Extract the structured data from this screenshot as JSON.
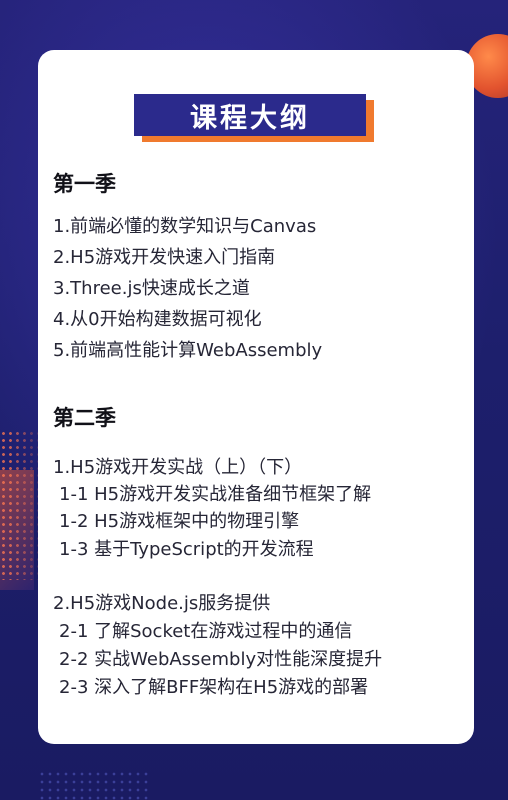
{
  "title": "课程大纲",
  "season1": {
    "heading": "第一季",
    "items": [
      "1.前端必懂的数学知识与Canvas",
      "2.H5游戏开发快速入门指南",
      "3.Three.js快速成长之道",
      "4.从0开始构建数据可视化",
      "5.前端高性能计算WebAssembly"
    ]
  },
  "season2": {
    "heading": "第二季",
    "group1": {
      "title": "1.H5游戏开发实战（上）（下）",
      "items": [
        "1-1 H5游戏开发实战准备细节框架了解",
        "1-2 H5游戏框架中的物理引擎",
        "1-3 基于TypeScript的开发流程"
      ]
    },
    "group2": {
      "title": "2.H5游戏Node.js服务提供",
      "items": [
        "2-1 了解Socket在游戏过程中的通信",
        "2-2 实战WebAssembly对性能深度提升",
        "2-3 深入了解BFF架构在H5游戏的部署"
      ]
    }
  },
  "colors": {
    "background": "#1e1f6e",
    "title_box": "#2b2a8c",
    "accent": "#f07a2e",
    "card": "#ffffff"
  }
}
